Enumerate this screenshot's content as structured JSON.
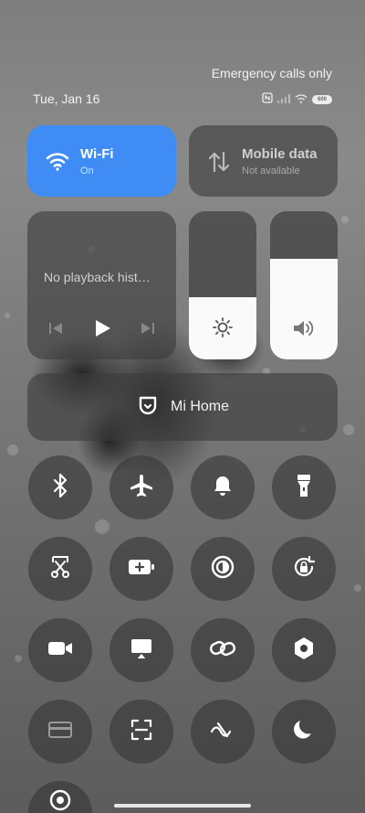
{
  "status": {
    "emergency_text": "Emergency calls only",
    "date": "Tue, Jan 16",
    "battery_label": "600",
    "icons": [
      "nfc-icon",
      "cellular-signal-icon",
      "wifi-signal-icon",
      "battery-icon"
    ]
  },
  "wifi": {
    "title": "Wi-Fi",
    "status": "On",
    "active": true,
    "color": "#3f8cf5"
  },
  "mobile_data": {
    "title": "Mobile data",
    "status": "Not available"
  },
  "media": {
    "text": "No playback hist…"
  },
  "brightness": {
    "level": 0.42,
    "icon": "sun-icon"
  },
  "volume": {
    "level": 0.68,
    "icon": "speaker-icon"
  },
  "mi_home": {
    "label": "Mi Home"
  },
  "toggles": [
    "bluetooth-icon",
    "airplane-icon",
    "bell-icon",
    "flashlight-icon",
    "scissors-screenshot-icon",
    "battery-saver-icon",
    "contrast-icon",
    "rotation-lock-icon",
    "video-icon",
    "screen-cast-icon",
    "link-icon",
    "hexagon-settings-icon",
    "card-icon",
    "scan-icon",
    "no-signal-icon",
    "moon-icon",
    "location-icon"
  ]
}
